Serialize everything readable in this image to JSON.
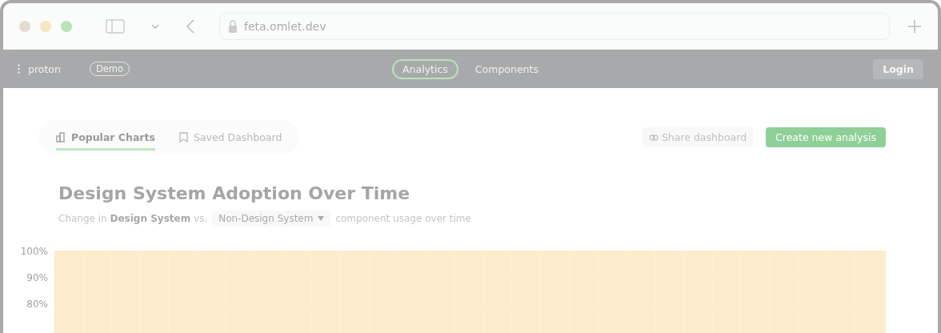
{
  "browser": {
    "url": "feta.omlet.dev"
  },
  "navbar": {
    "brand": "proton",
    "badge": "Demo",
    "links": [
      {
        "label": "Analytics",
        "selected": true
      },
      {
        "label": "Components",
        "selected": false
      }
    ],
    "login": "Login"
  },
  "tabs": [
    {
      "label": "Popular Charts",
      "selected": true,
      "kind": "chart"
    },
    {
      "label": "Saved Dashboard",
      "selected": false,
      "kind": "bookmark"
    }
  ],
  "actions": {
    "share": "Share dashboard",
    "create": "Create new analysis"
  },
  "title": "Design System Adoption Over Time",
  "subtitle": {
    "before": "Change in **Design System** vs.",
    "dropdown": "Non-Design System",
    "after": "component usage over time"
  },
  "chart": {
    "yticks": [
      "100%",
      "90%",
      "80%"
    ]
  }
}
